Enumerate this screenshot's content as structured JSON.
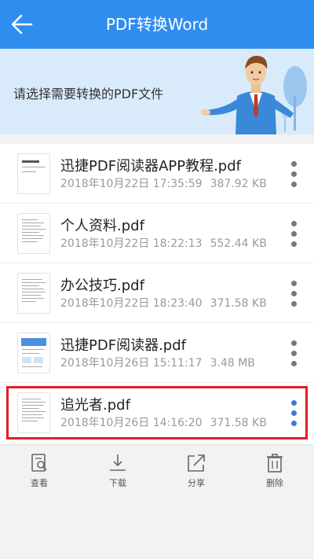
{
  "header": {
    "title": "PDF转换Word",
    "back_icon": "arrow-left-icon",
    "bg_color": "#2f8df0"
  },
  "banner": {
    "text": "请选择需要转换的PDF文件",
    "bg_color": "#d9ebfb",
    "illustration": "businessman-illustration"
  },
  "files": [
    {
      "name": "迅捷PDF阅读器APP教程.pdf",
      "date": "2018年10月22日 17:35:59",
      "size": "387.92 KB",
      "selected": false
    },
    {
      "name": "个人资料.pdf",
      "date": "2018年10月22日 18:22:13",
      "size": "552.44 KB",
      "selected": false
    },
    {
      "name": "办公技巧.pdf",
      "date": "2018年10月22日 18:23:40",
      "size": "371.58 KB",
      "selected": false
    },
    {
      "name": "迅捷PDF阅读器.pdf",
      "date": "2018年10月26日 15:11:17",
      "size": "3.48 MB",
      "selected": false
    },
    {
      "name": "追光者.pdf",
      "date": "2018年10月26日 14:16:20",
      "size": "371.58 KB",
      "selected": true
    }
  ],
  "toolbar": {
    "view_label": "查看",
    "download_label": "下载",
    "share_label": "分享",
    "delete_label": "删除"
  },
  "colors": {
    "highlight": "#e01f2a",
    "selected_dots": "#3a7bd5"
  }
}
